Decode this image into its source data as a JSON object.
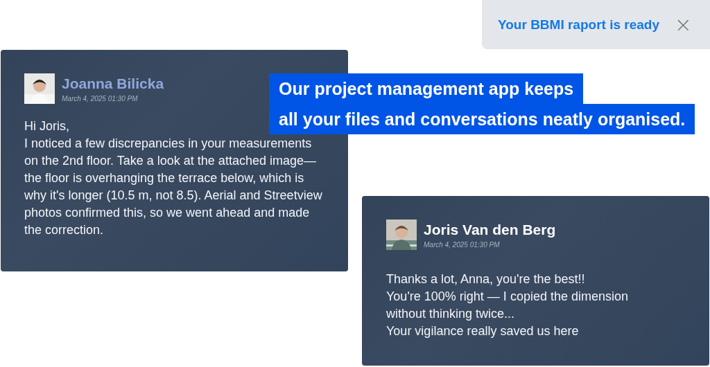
{
  "toast": {
    "message": "Your BBMI raport is ready",
    "close": "×"
  },
  "messages": [
    {
      "author": "Joanna Bilicka",
      "color": "#8fa8dc",
      "time": "March 4, 2025 01:30 PM",
      "paragraphs": [
        "Hi Joris,",
        "I noticed a few discrepancies in your measurements on the 2nd floor. Take a look at the attached image—the floor is overhanging the terrace below, which is why it's longer (10.5 m, not 8.5). Aerial and Streetview photos confirmed this, so we went ahead and made the correction."
      ]
    },
    {
      "author": "Joris Van den Berg",
      "color": "#ffffff",
      "time": "March 4, 2025 01:30 PM",
      "paragraphs": [
        "Thanks a lot, Anna, you're the best!!",
        "You're 100% right — I copied the dimension without thinking twice...",
        "Your vigilance really saved us here"
      ]
    }
  ],
  "callout": {
    "lines": [
      "Our project management app keeps",
      "all your files and conversations neatly organised."
    ]
  }
}
